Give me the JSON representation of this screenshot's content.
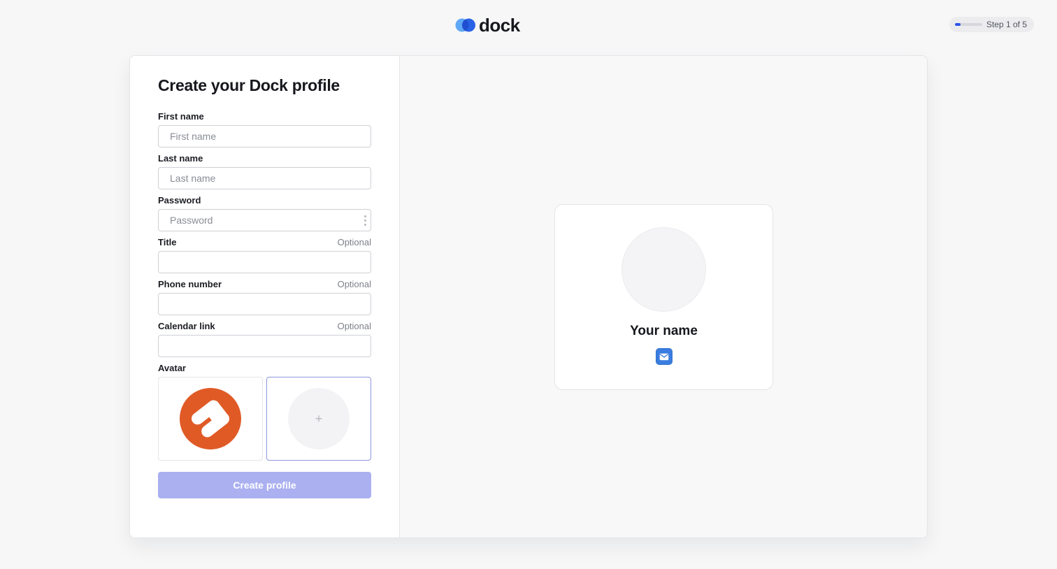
{
  "brand": {
    "name": "dock",
    "colors": {
      "accent": "#2b53e6",
      "logo_light": "#5fa8f5",
      "logo_dark": "#2a62e5"
    }
  },
  "progress": {
    "label": "Step 1 of 5",
    "current": 1,
    "total": 5
  },
  "form": {
    "title": "Create your Dock profile",
    "fields": {
      "first_name": {
        "label": "First name",
        "placeholder": "First name",
        "value": ""
      },
      "last_name": {
        "label": "Last name",
        "placeholder": "Last name",
        "value": ""
      },
      "password": {
        "label": "Password",
        "placeholder": "Password",
        "value": ""
      },
      "title": {
        "label": "Title",
        "optional": "Optional",
        "value": ""
      },
      "phone": {
        "label": "Phone number",
        "optional": "Optional",
        "value": ""
      },
      "calendar": {
        "label": "Calendar link",
        "optional": "Optional",
        "value": ""
      }
    },
    "avatar": {
      "label": "Avatar",
      "options": [
        {
          "icon": "company-logo-icon",
          "color": "#e05a26"
        },
        {
          "icon": "plus-icon",
          "glyph": "+"
        }
      ]
    },
    "submit_label": "Create profile",
    "submit_color": "#aab0f0"
  },
  "preview": {
    "name": "Your name",
    "contact_icon": "email-icon"
  }
}
